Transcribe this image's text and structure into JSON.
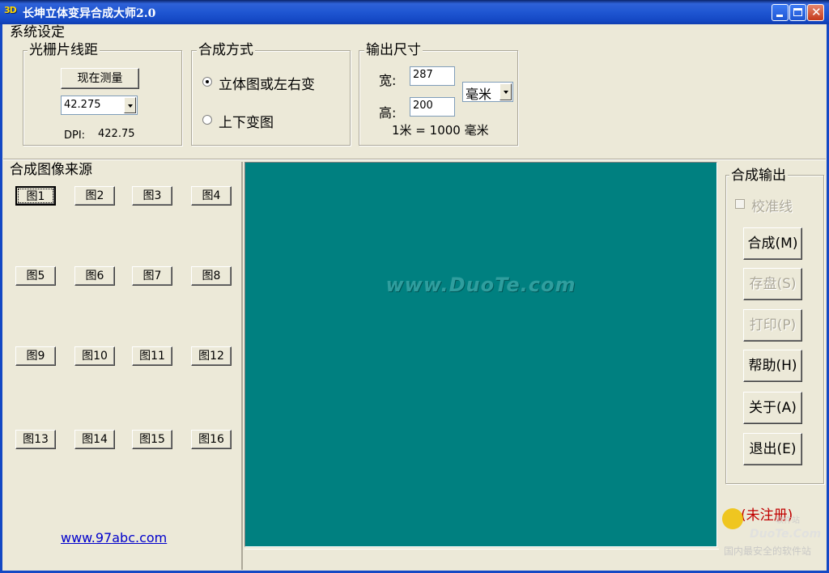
{
  "window": {
    "title": "长坤立体变异合成大师2.0",
    "icon_label": "3D"
  },
  "settings": {
    "label": "系统设定",
    "grating": {
      "label": "光栅片线距",
      "measure_button": "现在测量",
      "pitch_value": "42.275",
      "dpi_label": "DPI:",
      "dpi_value": "422.75"
    },
    "synthesis": {
      "label": "合成方式",
      "options": [
        "立体图或左右变",
        "上下变图"
      ],
      "selected_index": 0
    },
    "output_size": {
      "label": "输出尺寸",
      "width_label": "宽:",
      "width_value": "287",
      "height_label": "高:",
      "height_value": "200",
      "unit": "毫米",
      "unit_note": "1米 = 1000 毫米"
    }
  },
  "sources": {
    "label": "合成图像来源",
    "buttons": [
      "图1",
      "图2",
      "图3",
      "图4",
      "图5",
      "图6",
      "图7",
      "图8",
      "图9",
      "图10",
      "图11",
      "图12",
      "图13",
      "图14",
      "图15",
      "图16"
    ],
    "link": "www.97abc.com"
  },
  "preview": {
    "watermark": "www.DuoTe.com",
    "background": "#008080"
  },
  "output": {
    "label": "合成输出",
    "calibration_label": "校准线",
    "buttons": {
      "compose": "合成(M)",
      "save": "存盘(S)",
      "print": "打印(P)",
      "help": "帮助(H)",
      "about": "关于(A)",
      "exit": "退出(E)"
    },
    "registration_status": "(未注册)"
  },
  "site_logo": {
    "text": "DuoTe.Com",
    "slogan": "国内最安全的软件站",
    "tag": "软件站"
  }
}
